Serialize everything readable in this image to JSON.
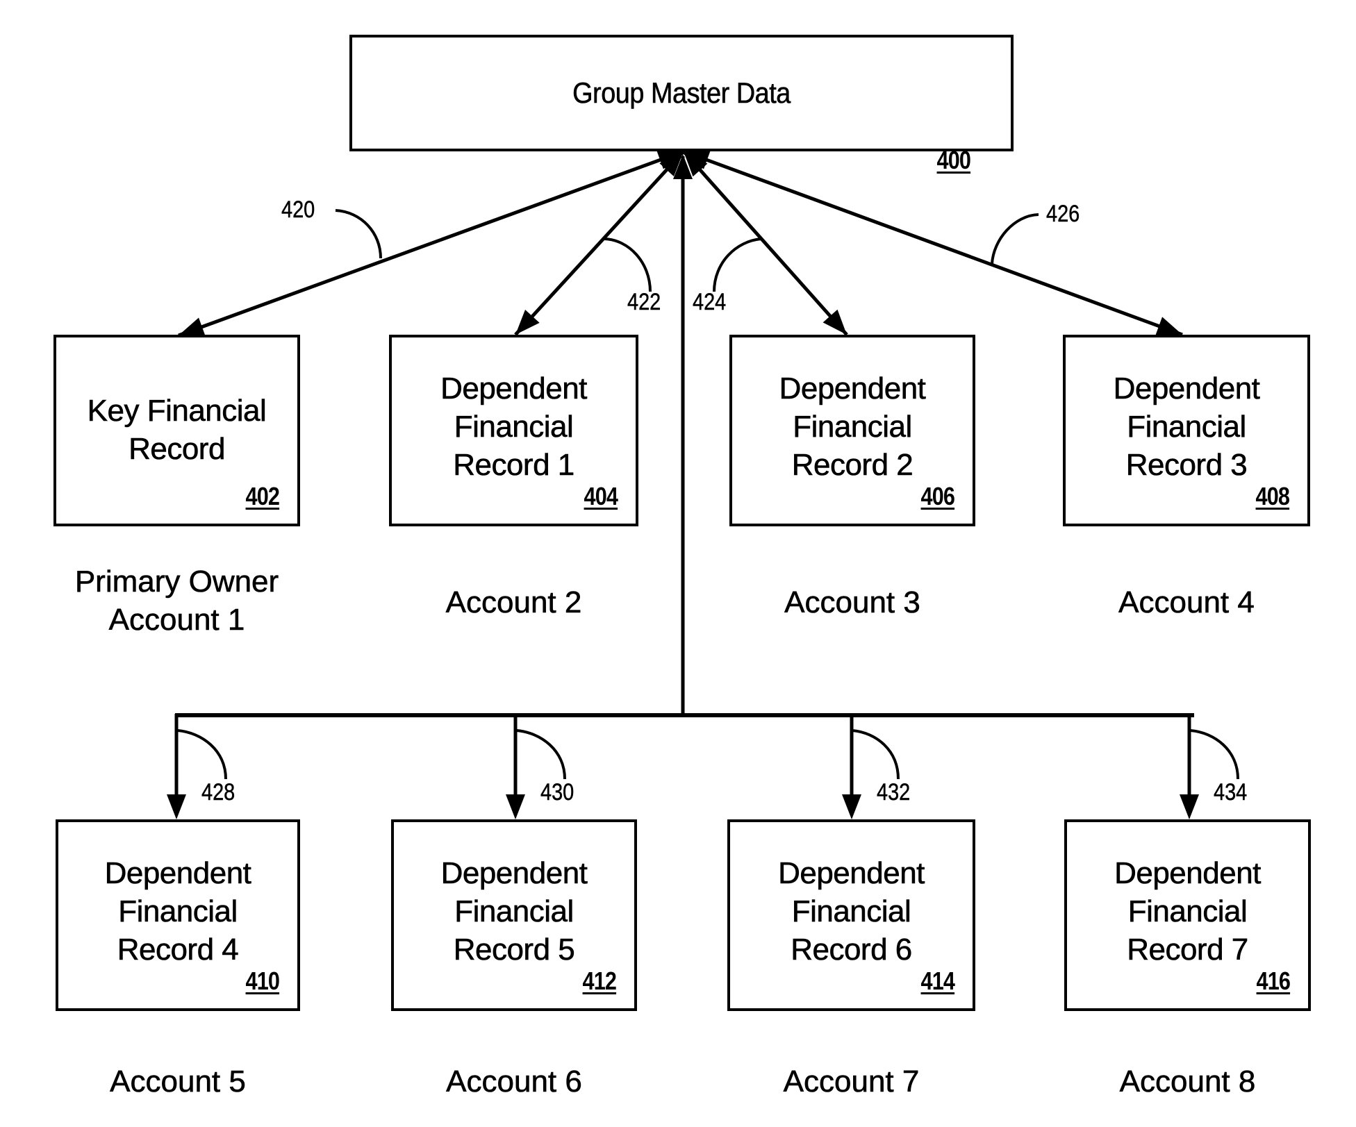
{
  "master": {
    "title": "Group Master Data",
    "ref": "400"
  },
  "records": [
    {
      "lines": [
        "Key Financial",
        "Record"
      ],
      "ref": "402",
      "account": [
        "Primary Owner",
        "Account 1"
      ],
      "connector": "420"
    },
    {
      "lines": [
        "Dependent",
        "Financial",
        "Record 1"
      ],
      "ref": "404",
      "account": [
        "Account 2"
      ],
      "connector": "422"
    },
    {
      "lines": [
        "Dependent",
        "Financial",
        "Record 2"
      ],
      "ref": "406",
      "account": [
        "Account 3"
      ],
      "connector": "424"
    },
    {
      "lines": [
        "Dependent",
        "Financial",
        "Record 3"
      ],
      "ref": "408",
      "account": [
        "Account 4"
      ],
      "connector": "426"
    },
    {
      "lines": [
        "Dependent",
        "Financial",
        "Record 4"
      ],
      "ref": "410",
      "account": [
        "Account 5"
      ],
      "connector": "428"
    },
    {
      "lines": [
        "Dependent",
        "Financial",
        "Record 5"
      ],
      "ref": "412",
      "account": [
        "Account 6"
      ],
      "connector": "430"
    },
    {
      "lines": [
        "Dependent",
        "Financial",
        "Record 6"
      ],
      "ref": "414",
      "account": [
        "Account 7"
      ],
      "connector": "432"
    },
    {
      "lines": [
        "Dependent",
        "Financial",
        "Record 7"
      ],
      "ref": "416",
      "account": [
        "Account 8"
      ],
      "connector": "434"
    }
  ],
  "colors": {
    "ink": "#000000",
    "background": "#ffffff"
  }
}
